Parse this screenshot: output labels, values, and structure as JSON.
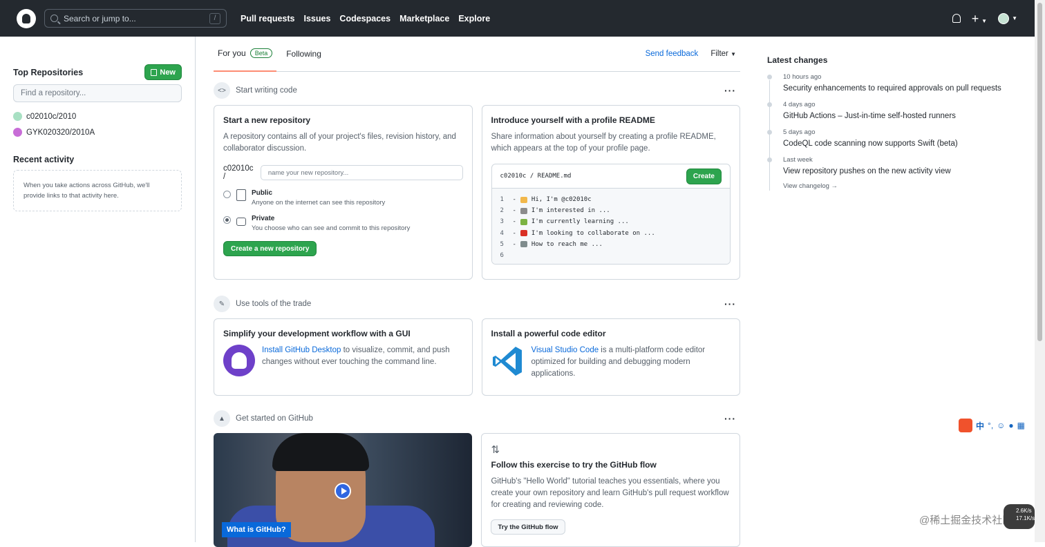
{
  "header": {
    "search_placeholder": "Search or jump to...",
    "search_shortcut": "/",
    "nav": [
      "Pull requests",
      "Issues",
      "Codespaces",
      "Marketplace",
      "Explore"
    ]
  },
  "sidebar": {
    "top_repos_title": "Top Repositories",
    "new_label": "New",
    "find_placeholder": "Find a repository...",
    "repos": [
      {
        "name": "c02010c/2010",
        "color": "#a8e0c3"
      },
      {
        "name": "GYK020320/2010A",
        "color": "#c86dd7"
      }
    ],
    "recent_title": "Recent activity",
    "recent_empty": "When you take actions across GitHub, we'll provide links to that activity here."
  },
  "feed": {
    "tabs": [
      {
        "label": "For you",
        "badge": "Beta"
      },
      {
        "label": "Following"
      }
    ],
    "send_feedback": "Send feedback",
    "filter": "Filter",
    "sections": [
      "Start writing code",
      "Use tools of the trade",
      "Get started on GitHub"
    ],
    "new_repo": {
      "title": "Start a new repository",
      "desc": "A repository contains all of your project's files, revision history, and collaborator discussion.",
      "owner": "c02010c /",
      "name_placeholder": "name your new repository...",
      "public_title": "Public",
      "public_desc": "Anyone on the internet can see this repository",
      "private_title": "Private",
      "private_desc": "You choose who can see and commit to this repository",
      "create_label": "Create a new repository"
    },
    "readme": {
      "title": "Introduce yourself with a profile README",
      "desc": "Share information about yourself by creating a profile README, which appears at the top of your profile page.",
      "path": "c02010c / README.md",
      "create_label": "Create",
      "lines": [
        {
          "n": "1",
          "text": "Hi, I'm @c02010c",
          "emoji_color": "#f2b84b"
        },
        {
          "n": "2",
          "text": "I'm interested in ...",
          "emoji_color": "#8c8c8c"
        },
        {
          "n": "3",
          "text": "I'm currently learning ...",
          "emoji_color": "#7cb342"
        },
        {
          "n": "4",
          "text": "I'm looking to collaborate on ...",
          "emoji_color": "#d93025"
        },
        {
          "n": "5",
          "text": "How to reach me ...",
          "emoji_color": "#7f8c8d"
        },
        {
          "n": "6",
          "text": "",
          "emoji_color": ""
        }
      ]
    },
    "desktop": {
      "title": "Simplify your development workflow with a GUI",
      "link": "Install GitHub Desktop",
      "rest": " to visualize, commit, and push changes without ever touching the command line."
    },
    "editor": {
      "title": "Install a powerful code editor",
      "link": "Visual Studio Code",
      "rest": " is a multi-platform code editor optimized for building and debugging modern applications."
    },
    "video_label": "What is GitHub?",
    "flow": {
      "title": "Follow this exercise to try the GitHub flow",
      "desc": "GitHub's \"Hello World\" tutorial teaches you essentials, where you create your own repository and learn GitHub's pull request workflow for creating and reviewing code.",
      "button": "Try the GitHub flow"
    }
  },
  "changes": {
    "title": "Latest changes",
    "items": [
      {
        "date": "10 hours ago",
        "title": "Security enhancements to required approvals on pull requests"
      },
      {
        "date": "4 days ago",
        "title": "GitHub Actions – Just-in-time self-hosted runners"
      },
      {
        "date": "5 days ago",
        "title": "CodeQL code scanning now supports Swift (beta)"
      },
      {
        "date": "Last week",
        "title": "View repository pushes on the new activity view"
      }
    ],
    "changelog": "View changelog →"
  },
  "overlay": {
    "ime_lang": "中",
    "watermark": "@稀土掘金技术社区",
    "net_up": "2.6",
    "net_down": "17.1",
    "net_unit": "K/s"
  }
}
